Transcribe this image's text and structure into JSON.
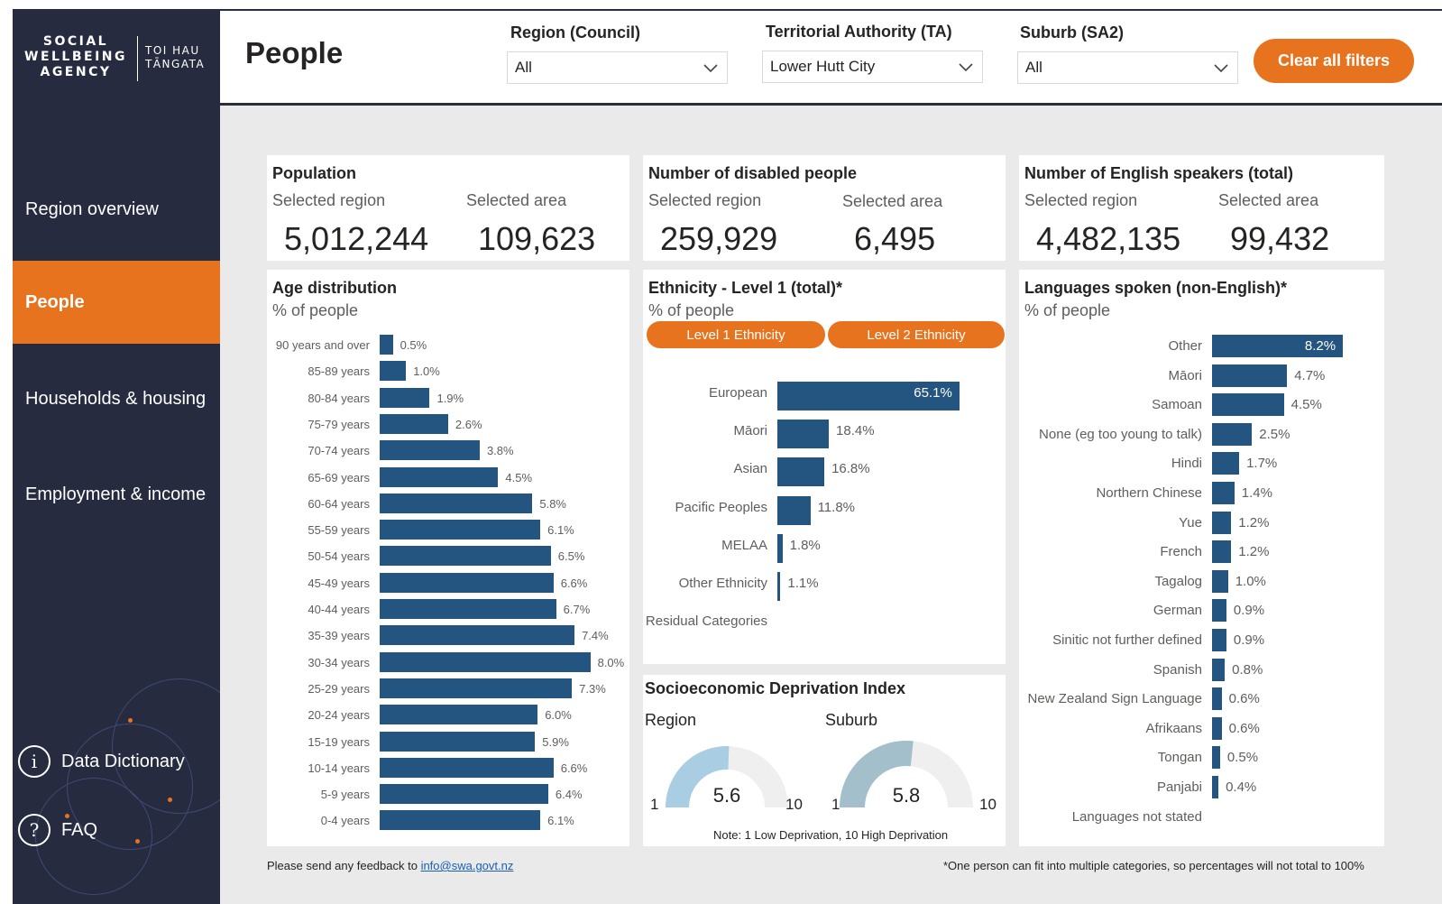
{
  "logo": {
    "main_line1": "SOCIAL",
    "main_line2": "WELLBEING",
    "main_line3": "AGENCY",
    "sub_line1": "TOI HAU",
    "sub_line2": "TĀNGATA"
  },
  "sidebar": {
    "items": [
      {
        "label": "Region overview",
        "active": false
      },
      {
        "label": "People",
        "active": true
      },
      {
        "label": "Households & housing",
        "active": false
      },
      {
        "label": "Employment & income",
        "active": false
      }
    ],
    "data_dictionary": "Data Dictionary",
    "data_dictionary_icon": "i",
    "faq": "FAQ",
    "faq_icon": "?"
  },
  "header": {
    "title": "People",
    "filters": [
      {
        "label": "Region (Council)",
        "value": "All"
      },
      {
        "label": "Territorial Authority (TA)",
        "value": "Lower Hutt City"
      },
      {
        "label": "Suburb (SA2)",
        "value": "All"
      }
    ],
    "clear_button": "Clear all filters"
  },
  "kpis": {
    "population": {
      "title": "Population",
      "region_label": "Selected region",
      "area_label": "Selected area",
      "region_value": "5,012,244",
      "area_value": "109,623"
    },
    "disabled": {
      "title": "Number of disabled people",
      "region_label": "Selected region",
      "area_label": "Selected area",
      "region_value": "259,929",
      "area_value": "6,495"
    },
    "english": {
      "title": "Number of English speakers (total)",
      "region_label": "Selected region",
      "area_label": "Selected area",
      "region_value": "4,482,135",
      "area_value": "99,432"
    }
  },
  "age": {
    "title": "Age distribution",
    "subtitle": "% of people",
    "chart_data": {
      "type": "bar",
      "orientation": "horizontal",
      "categories": [
        "90 years and over",
        "85-89 years",
        "80-84 years",
        "75-79 years",
        "70-74 years",
        "65-69 years",
        "60-64 years",
        "55-59 years",
        "50-54 years",
        "45-49 years",
        "40-44 years",
        "35-39 years",
        "30-34 years",
        "25-29 years",
        "20-24 years",
        "15-19 years",
        "10-14 years",
        "5-9 years",
        "0-4 years"
      ],
      "values": [
        0.5,
        1.0,
        1.9,
        2.6,
        3.8,
        4.5,
        5.8,
        6.1,
        6.5,
        6.6,
        6.7,
        7.4,
        8.0,
        7.3,
        6.0,
        5.9,
        6.6,
        6.4,
        6.1
      ],
      "labels": [
        "0.5%",
        "1.0%",
        "1.9%",
        "2.6%",
        "3.8%",
        "4.5%",
        "5.8%",
        "6.1%",
        "6.5%",
        "6.6%",
        "6.7%",
        "7.4%",
        "8.0%",
        "7.3%",
        "6.0%",
        "5.9%",
        "6.6%",
        "6.4%",
        "6.1%"
      ]
    }
  },
  "ethnicity": {
    "title": "Ethnicity - Level 1 (total)*",
    "subtitle": "% of people",
    "toggle_1": "Level 1 Ethnicity",
    "toggle_2": "Level 2 Ethnicity",
    "chart_data": {
      "type": "bar",
      "orientation": "horizontal",
      "categories": [
        "European",
        "Māori",
        "Asian",
        "Pacific Peoples",
        "MELAA",
        "Other Ethnicity",
        "Residual Categories"
      ],
      "values": [
        65.1,
        18.4,
        16.8,
        11.8,
        1.8,
        1.1,
        null
      ],
      "labels": [
        "65.1%",
        "18.4%",
        "16.8%",
        "11.8%",
        "1.8%",
        "1.1%",
        ""
      ]
    }
  },
  "deprivation": {
    "title": "Socioeconomic Deprivation Index",
    "region_label": "Region",
    "suburb_label": "Suburb",
    "region_value": 5.6,
    "region_value_text": "5.6",
    "suburb_value": 5.8,
    "suburb_value_text": "5.8",
    "min_text": "1",
    "max_text": "10",
    "min": 1,
    "max": 10,
    "note": "Note: 1 Low Deprivation, 10 High Deprivation",
    "region_color": "#a9cde3",
    "suburb_color": "#a3bfcc"
  },
  "languages": {
    "title": "Languages spoken (non-English)*",
    "subtitle": "% of people",
    "chart_data": {
      "type": "bar",
      "orientation": "horizontal",
      "categories": [
        "Other",
        "Māori",
        "Samoan",
        "None (eg too young to talk)",
        "Hindi",
        "Northern Chinese",
        "Yue",
        "French",
        "Tagalog",
        "German",
        "Sinitic not further defined",
        "Spanish",
        "New Zealand Sign Language",
        "Afrikaans",
        "Tongan",
        "Panjabi",
        "Languages not stated"
      ],
      "values": [
        8.2,
        4.7,
        4.5,
        2.5,
        1.7,
        1.4,
        1.2,
        1.2,
        1.0,
        0.9,
        0.9,
        0.8,
        0.6,
        0.6,
        0.5,
        0.4,
        null
      ],
      "labels": [
        "8.2%",
        "4.7%",
        "4.5%",
        "2.5%",
        "1.7%",
        "1.4%",
        "1.2%",
        "1.2%",
        "1.0%",
        "0.9%",
        "0.9%",
        "0.8%",
        "0.6%",
        "0.6%",
        "0.5%",
        "0.4%",
        ""
      ]
    }
  },
  "footer": {
    "feedback_prefix": "Please send any feedback to ",
    "feedback_email": "info@swa.govt.nz",
    "note": "*One person can fit into multiple categories, so percentages will not total to 100%"
  },
  "colors": {
    "accent": "#e8731f",
    "sidebar": "#272b40",
    "bar": "#245580"
  }
}
